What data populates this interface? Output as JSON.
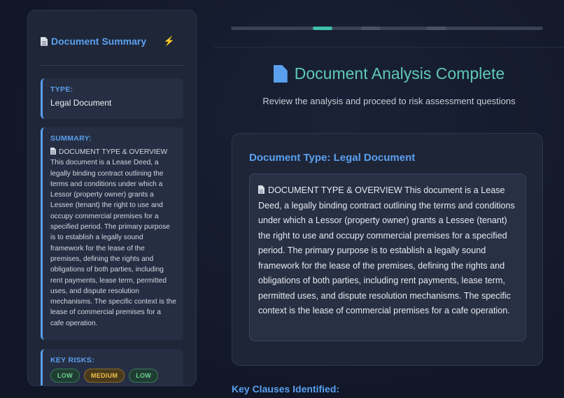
{
  "sidebar": {
    "title": "Document Summary",
    "header_icon": "lightning-icon",
    "type_card": {
      "label": "TYPE:",
      "value": "Legal Document"
    },
    "summary_card": {
      "label": "SUMMARY:",
      "text": "DOCUMENT TYPE & OVERVIEW This document is a Lease Deed, a legally binding contract outlining the terms and conditions under which a Lessor (property owner) grants a Lessee (tenant) the right to use and occupy commercial premises for a specified period. The primary purpose is to establish a legally sound framework for the lease of the premises, defining the rights and obligations of both parties, including rent payments, lease term, permitted uses, and dispute resolution mechanisms. The specific context is the lease of commercial premises for a cafe operation."
    },
    "risks_card": {
      "label": "KEY RISKS:",
      "badges": [
        "LOW",
        "MEDIUM",
        "LOW"
      ]
    }
  },
  "progress": {
    "active_step": 1,
    "colors": {
      "active": "#3fbfae",
      "inactive": "#4a5166",
      "track": "#3a4155"
    }
  },
  "main": {
    "title": "Document Analysis Complete",
    "subtitle": "Review the analysis and proceed to risk assessment questions",
    "analysis": {
      "title": "Document Type: Legal Document",
      "text": "DOCUMENT TYPE & OVERVIEW This document is a Lease Deed, a legally binding contract outlining the terms and conditions under which a Lessor (property owner) grants a Lessee (tenant) the right to use and occupy commercial premises for a specified period. The primary purpose is to establish a legally sound framework for the lease of the premises, defining the rights and obligations of both parties, including rent payments, lease term, permitted uses, and dispute resolution mechanisms. The specific context is the lease of commercial premises for a cafe operation."
    },
    "key_clauses_heading": "Key Clauses Identified:"
  },
  "colors": {
    "accent_blue": "#5aa0ee",
    "accent_teal": "#5fc9b5",
    "risk_low": "#6fd38f",
    "risk_medium": "#f0c24a",
    "background": "#141a2c"
  }
}
